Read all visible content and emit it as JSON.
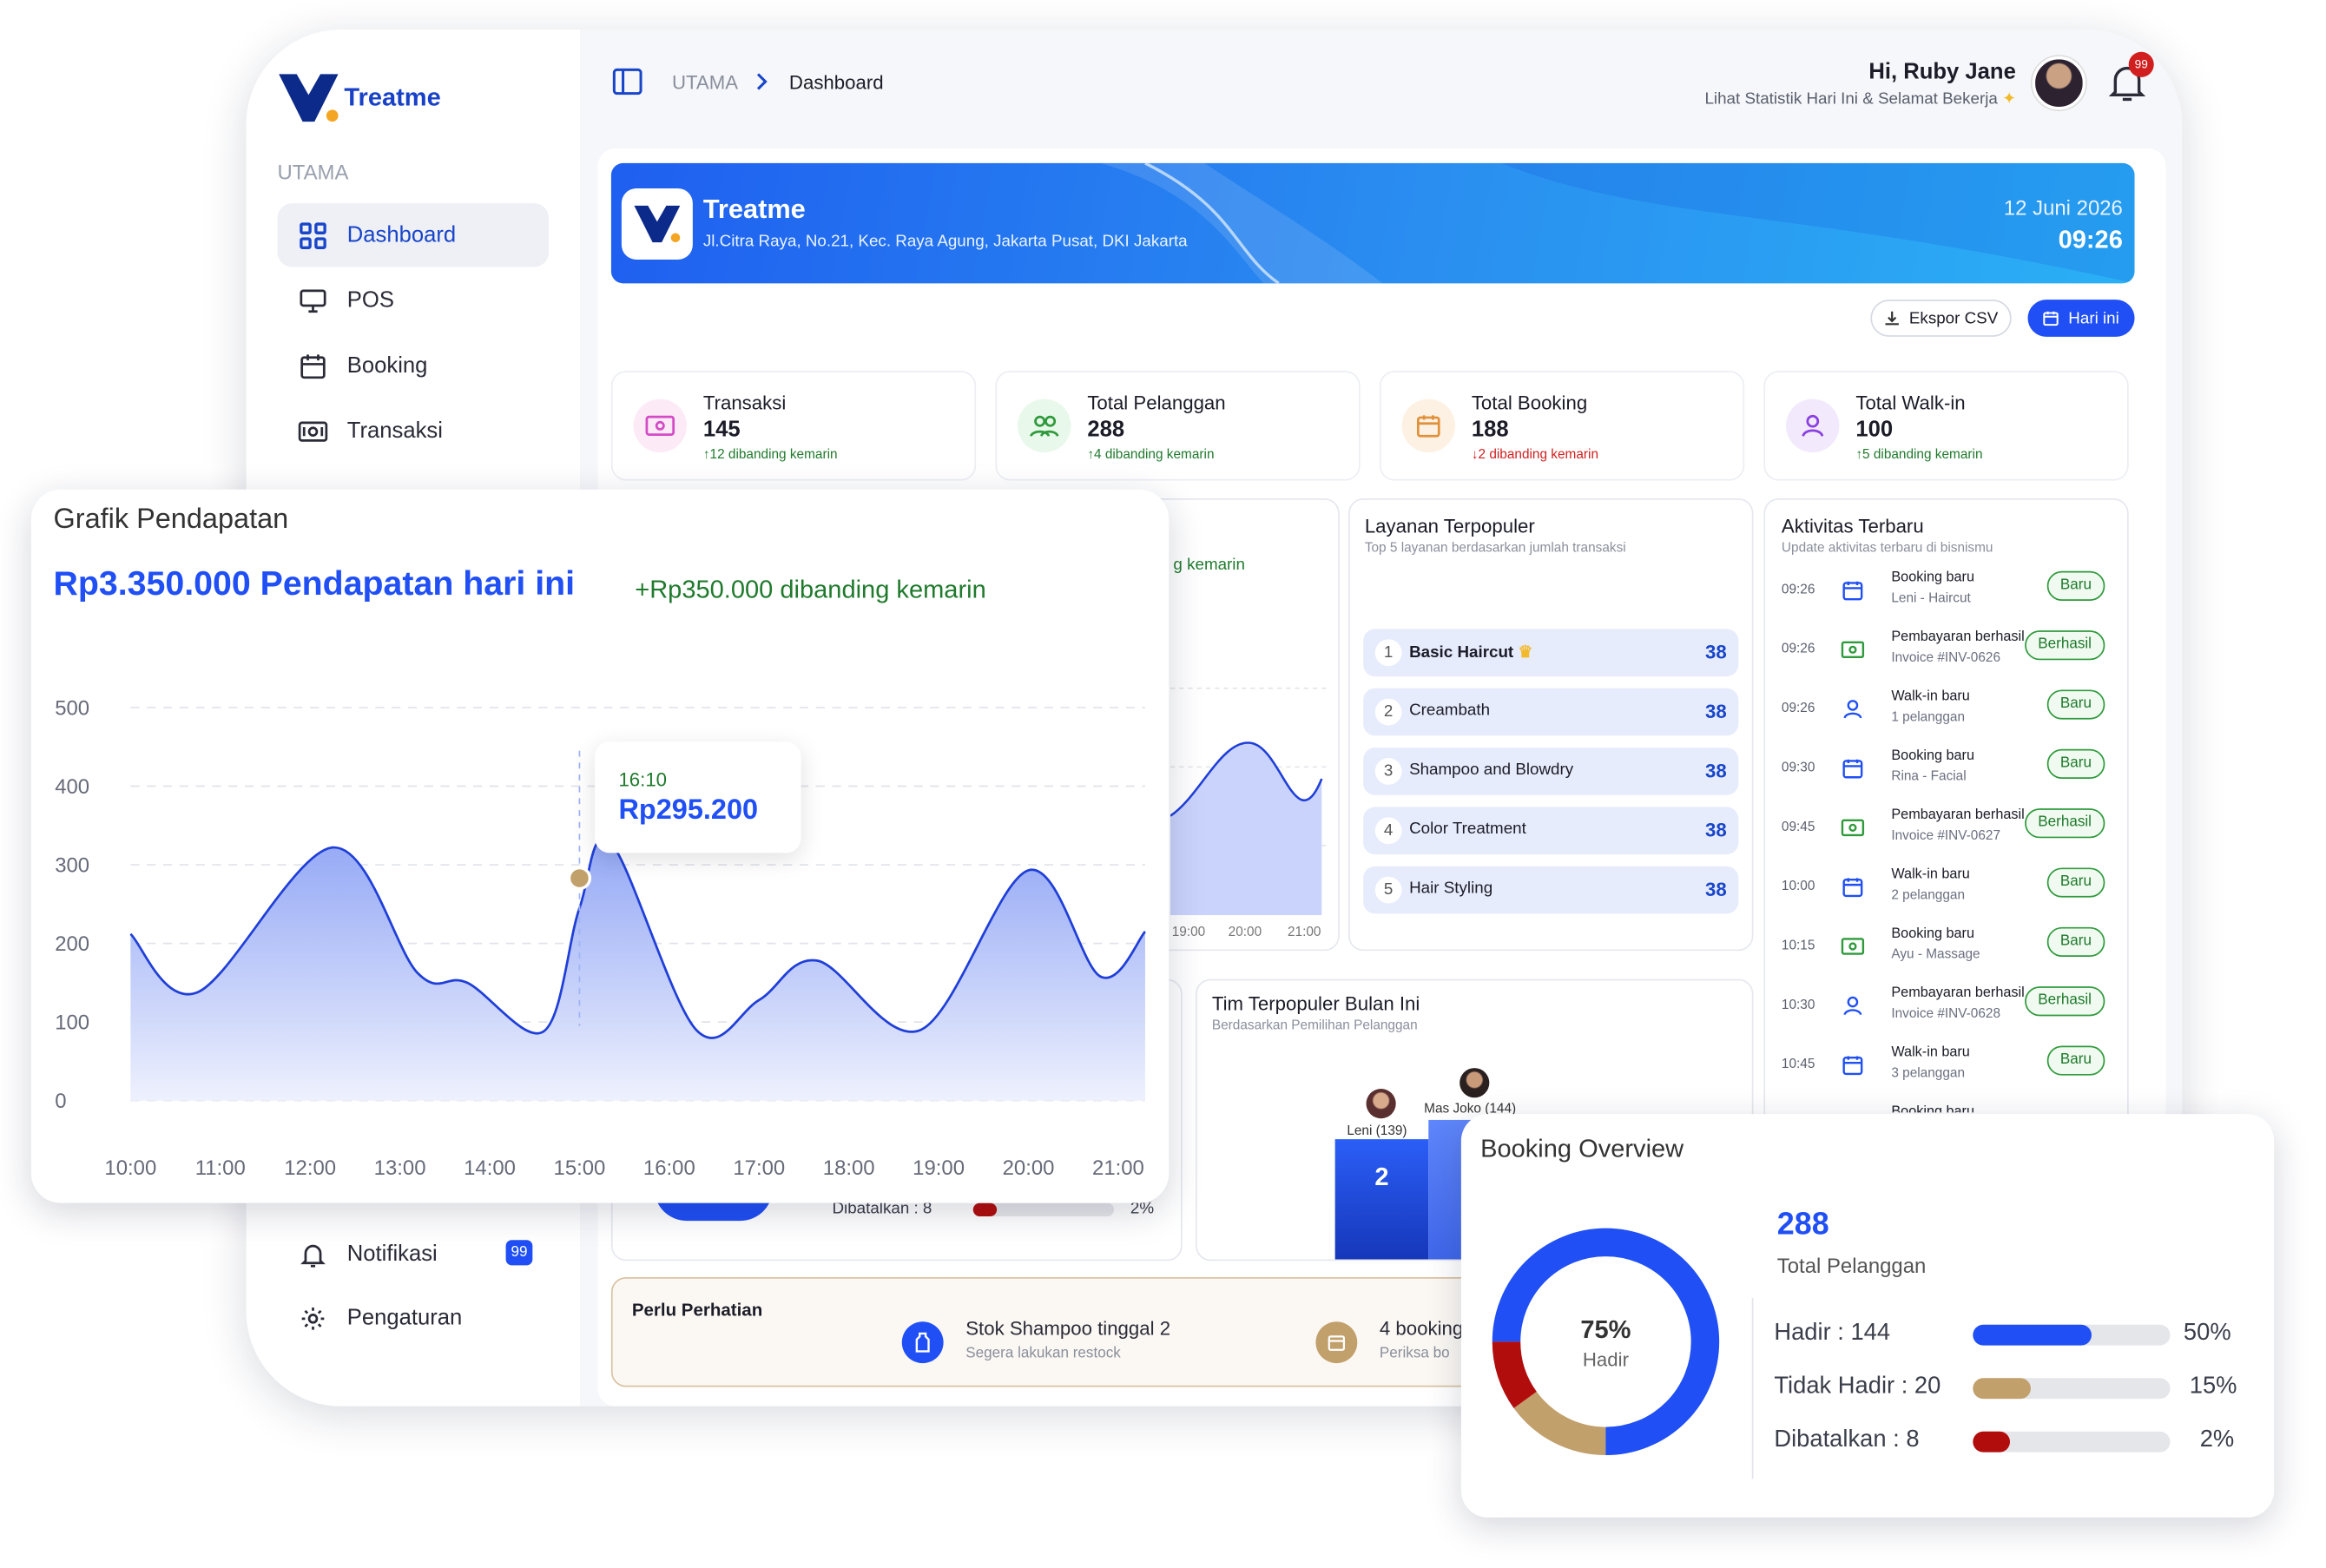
{
  "brand": {
    "name": "Treatme"
  },
  "sidebar": {
    "section_label": "UTAMA",
    "items": [
      {
        "label": "Dashboard",
        "icon": "grid-icon"
      },
      {
        "label": "POS",
        "icon": "monitor-icon"
      },
      {
        "label": "Booking",
        "icon": "calendar-icon"
      },
      {
        "label": "Transaksi",
        "icon": "money-icon"
      }
    ],
    "bottom_items": [
      {
        "label": "Notifikasi",
        "icon": "bell-icon",
        "badge": "99"
      },
      {
        "label": "Pengaturan",
        "icon": "gear-icon"
      }
    ]
  },
  "header": {
    "breadcrumb_root": "UTAMA",
    "breadcrumb_current": "Dashboard",
    "greeting": "Hi, Ruby Jane",
    "subtitle": "Lihat Statistik Hari Ini & Selamat Bekerja",
    "notification_count": "99"
  },
  "banner": {
    "name": "Treatme",
    "address": "Jl.Citra Raya, No.21, Kec. Raya Agung, Jakarta Pusat, DKI Jakarta",
    "date": "12 Juni 2026",
    "time": "09:26"
  },
  "actions": {
    "export_label": "Ekspor CSV",
    "today_label": "Hari ini"
  },
  "stats": [
    {
      "label": "Transaksi",
      "value": "145",
      "compare": "↑12 dibanding kemarin",
      "trend": "up"
    },
    {
      "label": "Total Pelanggan",
      "value": "288",
      "compare": "↑4 dibanding kemarin",
      "trend": "up"
    },
    {
      "label": "Total Booking",
      "value": "188",
      "compare": "↓2 dibanding kemarin",
      "trend": "down"
    },
    {
      "label": "Total Walk-in",
      "value": "100",
      "compare": "↑5 dibanding kemarin",
      "trend": "up"
    }
  ],
  "behind": {
    "compare_fragment": "g kemarin",
    "ticks": [
      "19:00",
      "20:00",
      "21:00"
    ],
    "dibatalkan_fragment": "Dibatalkan : 8",
    "pct_fragment": "2%"
  },
  "popular_services": {
    "title": "Layanan Terpopuler",
    "subtitle": "Top 5 layanan berdasarkan jumlah transaksi",
    "items": [
      {
        "rank": "1",
        "name": "Basic Haircut",
        "count": "38"
      },
      {
        "rank": "2",
        "name": "Creambath",
        "count": "38"
      },
      {
        "rank": "3",
        "name": "Shampoo and Blowdry",
        "count": "38"
      },
      {
        "rank": "4",
        "name": "Color Treatment",
        "count": "38"
      },
      {
        "rank": "5",
        "name": "Hair Styling",
        "count": "38"
      }
    ]
  },
  "activity": {
    "title": "Aktivitas Terbaru",
    "subtitle": "Update aktivitas terbaru di bisnismu",
    "items": [
      {
        "time": "09:26",
        "title": "Booking baru",
        "detail": "Leni - Haircut",
        "status": "Baru",
        "icon": "calendar-icon"
      },
      {
        "time": "09:26",
        "title": "Pembayaran berhasil",
        "detail": "Invoice #INV-0626",
        "status": "Berhasil",
        "icon": "money-icon"
      },
      {
        "time": "09:26",
        "title": "Walk-in baru",
        "detail": "1 pelanggan",
        "status": "Baru",
        "icon": "user-icon"
      },
      {
        "time": "09:30",
        "title": "Booking baru",
        "detail": "Rina - Facial",
        "status": "Baru",
        "icon": "calendar-icon"
      },
      {
        "time": "09:45",
        "title": "Pembayaran berhasil",
        "detail": "Invoice #INV-0627",
        "status": "Berhasil",
        "icon": "money-icon"
      },
      {
        "time": "10:00",
        "title": "Walk-in baru",
        "detail": "2 pelanggan",
        "status": "Baru",
        "icon": "calendar-icon"
      },
      {
        "time": "10:15",
        "title": "Booking baru",
        "detail": "Ayu - Massage",
        "status": "Baru",
        "icon": "money-icon"
      },
      {
        "time": "10:30",
        "title": "Pembayaran berhasil",
        "detail": "Invoice #INV-0628",
        "status": "Berhasil",
        "icon": "user-icon"
      },
      {
        "time": "10:45",
        "title": "Walk-in baru",
        "detail": "3 pelanggan",
        "status": "Baru",
        "icon": "calendar-icon"
      },
      {
        "time": "",
        "title": "Booking baru",
        "detail": "",
        "status": "",
        "icon": "calendar-icon"
      }
    ]
  },
  "team": {
    "title": "Tim Terpopuler Bulan Ini",
    "subtitle": "Berdasarkan Pemilihan Pelanggan",
    "members": [
      {
        "name": "Leni (139)",
        "rank": "2"
      },
      {
        "name": "Mas Joko (144)",
        "rank": ""
      }
    ]
  },
  "attention": {
    "title": "Perlu Perhatian",
    "items": [
      {
        "title": "Stok Shampoo tinggal 2",
        "subtitle": "Segera lakukan restock"
      },
      {
        "title": "4 booking",
        "subtitle": "Periksa bo"
      }
    ]
  },
  "revenue": {
    "title": "Grafik Pendapatan",
    "headline": "Rp3.350.000 Pendapatan hari ini",
    "compare": "+Rp350.000 dibanding kemarin",
    "tooltip_time": "16:10",
    "tooltip_value": "Rp295.200"
  },
  "chart_data": {
    "type": "area",
    "x": [
      "10:00",
      "11:00",
      "12:00",
      "13:00",
      "14:00",
      "15:00",
      "16:00",
      "17:00",
      "18:00",
      "19:00",
      "20:00",
      "21:00"
    ],
    "ylim": [
      0,
      500
    ],
    "yticks": [
      0,
      100,
      200,
      300,
      400,
      500
    ],
    "grid": true,
    "highlight": {
      "label": "16:10",
      "value": 295200
    },
    "points": [
      [
        10.0,
        212
      ],
      [
        10.75,
        138
      ],
      [
        12.25,
        322
      ],
      [
        13.2,
        162
      ],
      [
        13.75,
        150
      ],
      [
        14.6,
        88
      ],
      [
        15.0,
        245
      ],
      [
        15.35,
        328
      ],
      [
        16.3,
        90
      ],
      [
        17.0,
        128
      ],
      [
        17.65,
        178
      ],
      [
        18.8,
        90
      ],
      [
        20.0,
        293
      ],
      [
        20.8,
        158
      ],
      [
        21.3,
        215
      ]
    ],
    "colors": {
      "line": "#1f3fd8",
      "fill_top": "#8fa4f5",
      "fill_bottom": "#eef1fd"
    }
  },
  "booking_overview": {
    "title": "Booking Overview",
    "total_value": "288",
    "total_label": "Total Pelanggan",
    "center_pct": "75%",
    "center_label": "Hadir",
    "rows": [
      {
        "label": "Hadir : 144",
        "pct": "50%",
        "fraction": 0.5,
        "color": "#1f4ff5"
      },
      {
        "label": "Tidak Hadir : 20",
        "pct": "15%",
        "fraction": 0.15,
        "color": "#c2a06c"
      },
      {
        "label": "Dibatalkan : 8",
        "pct": "2%",
        "fraction": 0.02,
        "color": "#b20d0d"
      }
    ],
    "donut": [
      {
        "name": "Hadir",
        "fraction": 0.75,
        "color": "#1f4ff5"
      },
      {
        "name": "Tidak Hadir",
        "fraction": 0.15,
        "color": "#c2a06c"
      },
      {
        "name": "Dibatalkan",
        "fraction": 0.1,
        "color": "#b20d0d"
      }
    ]
  },
  "colors": {
    "accent": "#1f4ff5",
    "success": "#1f7a2c",
    "danger": "#d11f1f",
    "brand_dark": "#0b2a8a"
  }
}
